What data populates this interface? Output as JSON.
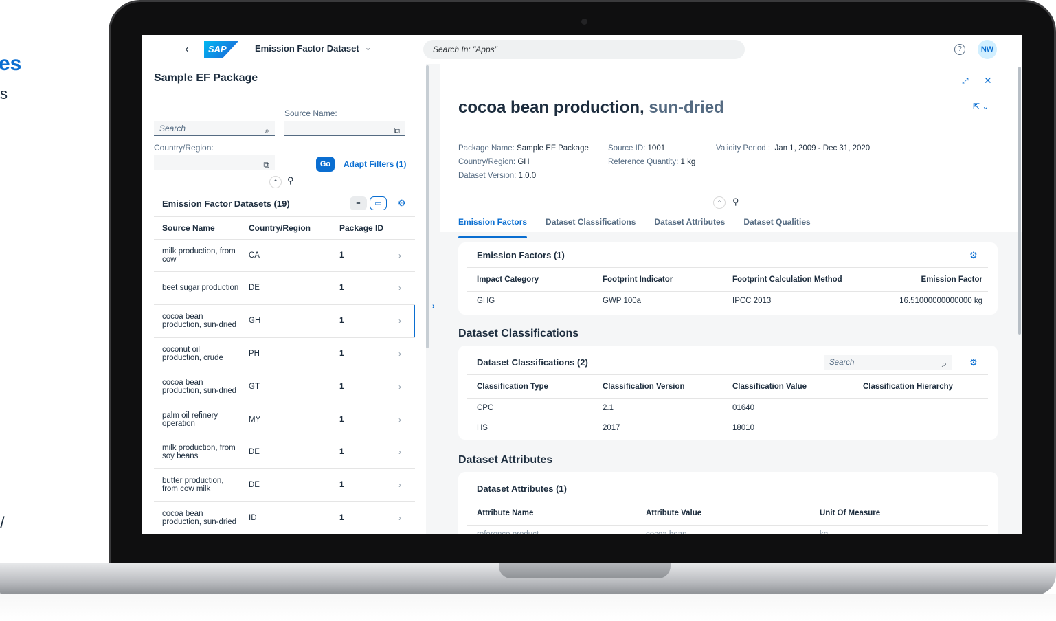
{
  "background_text": {
    "frag1": "es",
    "frag2": "s",
    "frag3": "/"
  },
  "shell": {
    "app_title": "Emission Factor Dataset",
    "logo_text": "SAP",
    "search_placeholder": "Search In: \"Apps\"",
    "avatar": "NW"
  },
  "left": {
    "title": "Sample EF Package",
    "search_placeholder": "Search",
    "source_name_label": "Source Name:",
    "country_label": "Country/Region:",
    "go": "Go",
    "adapt_filters": "Adapt Filters (1)",
    "table_title": "Emission Factor Datasets (19)",
    "columns": [
      "Source Name",
      "Country/Region",
      "Package ID"
    ],
    "rows": [
      {
        "name": "milk production, from cow",
        "country": "CA",
        "pkg": "1"
      },
      {
        "name": "beet sugar production",
        "country": "DE",
        "pkg": "1"
      },
      {
        "name": "cocoa bean production, sun-dried",
        "country": "GH",
        "pkg": "1"
      },
      {
        "name": "coconut oil production, crude",
        "country": "PH",
        "pkg": "1"
      },
      {
        "name": "cocoa bean production, sun-dried",
        "country": "GT",
        "pkg": "1"
      },
      {
        "name": "palm oil refinery operation",
        "country": "MY",
        "pkg": "1"
      },
      {
        "name": "milk production, from soy beans",
        "country": "DE",
        "pkg": "1"
      },
      {
        "name": "butter production, from cow milk",
        "country": "DE",
        "pkg": "1"
      },
      {
        "name": "cocoa bean production, sun-dried",
        "country": "ID",
        "pkg": "1"
      }
    ]
  },
  "object": {
    "title_main": "cocoa bean production,",
    "title_sub": " sun-dried",
    "package_label": "Package Name:",
    "package_value": "Sample EF Package",
    "country_label": "Country/Region:",
    "country_value": "GH",
    "version_label": "Dataset Version:",
    "version_value": "1.0.0",
    "source_id_label": "Source ID:",
    "source_id_value": "1001",
    "ref_qty_label": "Reference Quantity:",
    "ref_qty_value": "1 kg",
    "validity_label": "Validity Period :",
    "validity_value": "Jan 1, 2009 - Dec 31, 2020",
    "tabs": [
      "Emission Factors",
      "Dataset Classifications",
      "Dataset Attributes",
      "Dataset Qualities"
    ]
  },
  "ef": {
    "card_title": "Emission Factors (1)",
    "columns": [
      "Impact Category",
      "Footprint Indicator",
      "Footprint Calculation Method",
      "Emission Factor"
    ],
    "rows": [
      [
        "GHG",
        "GWP 100a",
        "IPCC 2013",
        "16.51000000000000 kg"
      ]
    ]
  },
  "classif": {
    "section_title": "Dataset Classifications",
    "card_title": "Dataset Classifications (2)",
    "search_placeholder": "Search",
    "columns": [
      "Classification Type",
      "Classification Version",
      "Classification Value",
      "Classification Hierarchy"
    ],
    "rows": [
      [
        "CPC",
        "2.1",
        "01640",
        ""
      ],
      [
        "HS",
        "2017",
        "18010",
        ""
      ]
    ]
  },
  "attrs": {
    "section_title": "Dataset Attributes",
    "card_title": "Dataset Attributes (1)",
    "columns": [
      "Attribute Name",
      "Attribute Value",
      "Unit Of Measure"
    ],
    "rows": [
      [
        "reference product",
        "cocoa bean",
        "kg"
      ]
    ]
  }
}
